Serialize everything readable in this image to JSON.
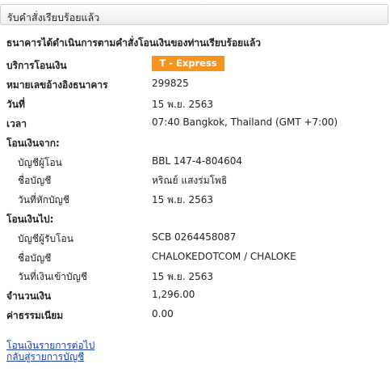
{
  "header": {
    "title": "รับคำสั่งเรียบร้อยแล้ว"
  },
  "status_message": "ธนาคารได้ดำเนินการตามคำสั่งโอนเงินของท่านเรียบร้อยแล้ว",
  "service": {
    "label": "บริการโอนเงิน",
    "value": "T - Express",
    "badge_color": "#f7941d"
  },
  "reference": {
    "label": "หมายเลขอ้างอิงธนาคาร",
    "value": "299825"
  },
  "date": {
    "label": "วันที่",
    "value": "15 พ.ย. 2563"
  },
  "time": {
    "label": "เวลา",
    "value": "07:40 Bangkok, Thailand (GMT +7:00)"
  },
  "from": {
    "heading": "โอนเงินจาก:",
    "account_label": "บัญชีผู้โอน",
    "account_value": "BBL 147-4-804604",
    "name_label": "ชื่อบัญชี",
    "name_value": "หริณย์ แสงร่มโพธิ",
    "debit_date_label": "วันที่หักบัญชี",
    "debit_date_value": "15 พ.ย. 2563"
  },
  "to": {
    "heading": "โอนเงินไป:",
    "account_label": "บัญชีผู้รับโอน",
    "account_value": "SCB 0264458087",
    "name_label": "ชื่อบัญชี",
    "name_value": "CHALOKEDOTCOM / CHALOKE",
    "credit_date_label": "วันที่เงินเข้าบัญชี",
    "credit_date_value": "15 พ.ย. 2563"
  },
  "amount": {
    "label": "จำนวนเงิน",
    "value": "1,296.00"
  },
  "fee": {
    "label": "ค่าธรรมเนียม",
    "value": "0.00"
  },
  "links": {
    "next_transfer": "โอนเงินรายการต่อไป",
    "back_to_accounts": "กลับสู่รายการบัญชี"
  }
}
